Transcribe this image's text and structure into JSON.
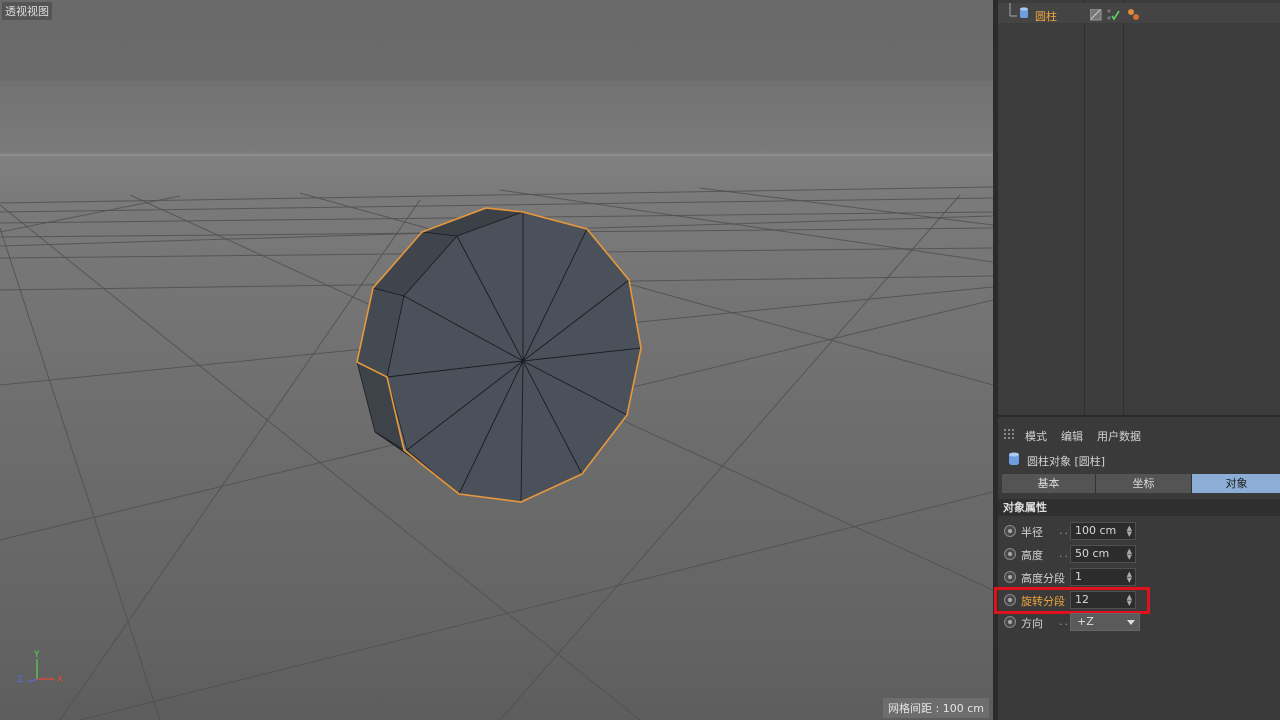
{
  "viewport": {
    "label": "透视视图",
    "grid_spacing": "网格间距 : 100 cm",
    "axis_labels": {
      "x": "X",
      "y": "Y",
      "z": "Z"
    },
    "selection_color": "#e8983a",
    "object_color": "#4b515b"
  },
  "object_manager": {
    "object_name": "圆柱",
    "object_icon": "cylinder-icon",
    "tags": [
      "display-tag-icon",
      "visibility-check-icon",
      "material-tag-icon"
    ]
  },
  "attributes": {
    "menu": [
      "模式",
      "编辑",
      "用户数据"
    ],
    "title": "圆柱对象 [圆柱]",
    "tabs": [
      {
        "label": "基本",
        "active": false
      },
      {
        "label": "坐标",
        "active": false
      },
      {
        "label": "对象",
        "active": true
      }
    ],
    "section": "对象属性",
    "params": [
      {
        "label": "半径",
        "dots": "...",
        "value": "100 cm"
      },
      {
        "label": "高度",
        "dots": "...",
        "value": "50 cm"
      },
      {
        "label": "高度分段",
        "dots": "",
        "value": "1"
      },
      {
        "label": "旋转分段",
        "dots": "",
        "value": "12",
        "highlighted": true
      },
      {
        "label": "方向",
        "dots": "...",
        "value": "+Z"
      }
    ],
    "highlight_color": "#e0111d",
    "active_tab_color": "#8caed6"
  }
}
